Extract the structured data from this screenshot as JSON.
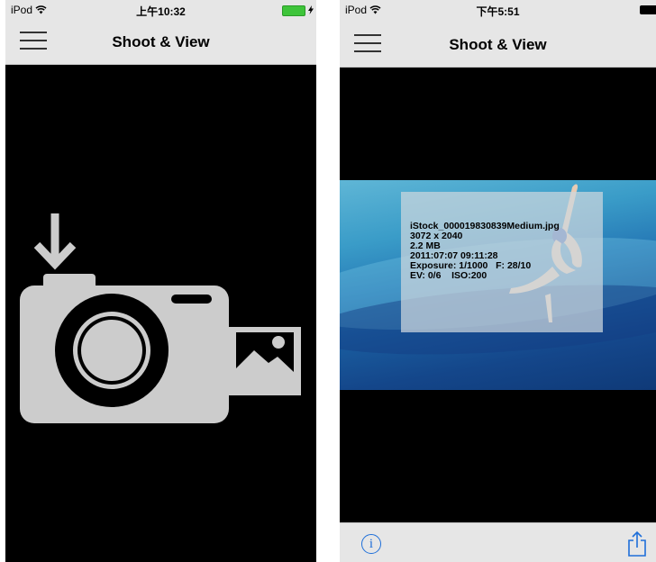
{
  "left_screen": {
    "status": {
      "carrier": "iPod",
      "time": "上午10:32"
    },
    "nav": {
      "title": "Shoot & View",
      "menu_icon": "hamburger-icon"
    },
    "main": {
      "illustration_icon": "camera-with-download-and-photo-icon",
      "background": "#000000"
    },
    "colors": {
      "icon": "#cccccc",
      "battery": "#3ec43a"
    }
  },
  "right_screen": {
    "status": {
      "carrier": "iPod",
      "time": "下午5:51"
    },
    "nav": {
      "title": "Shoot & View",
      "menu_icon": "hamburger-icon"
    },
    "photo_info": {
      "filename": "iStock_000019830839Medium.jpg",
      "dimensions": "3072 x 2040",
      "size": "2.2 MB",
      "datetime": "2011:07:07 09:11:28",
      "exposure": "Exposure: 1/1000   F: 28/10",
      "ev_iso": "EV: 0/6    ISO:200"
    },
    "toolbar": {
      "info_icon": "info-icon",
      "share_icon": "share-icon",
      "info_glyph": "i"
    },
    "colors": {
      "accent": "#1e6fd9"
    }
  }
}
